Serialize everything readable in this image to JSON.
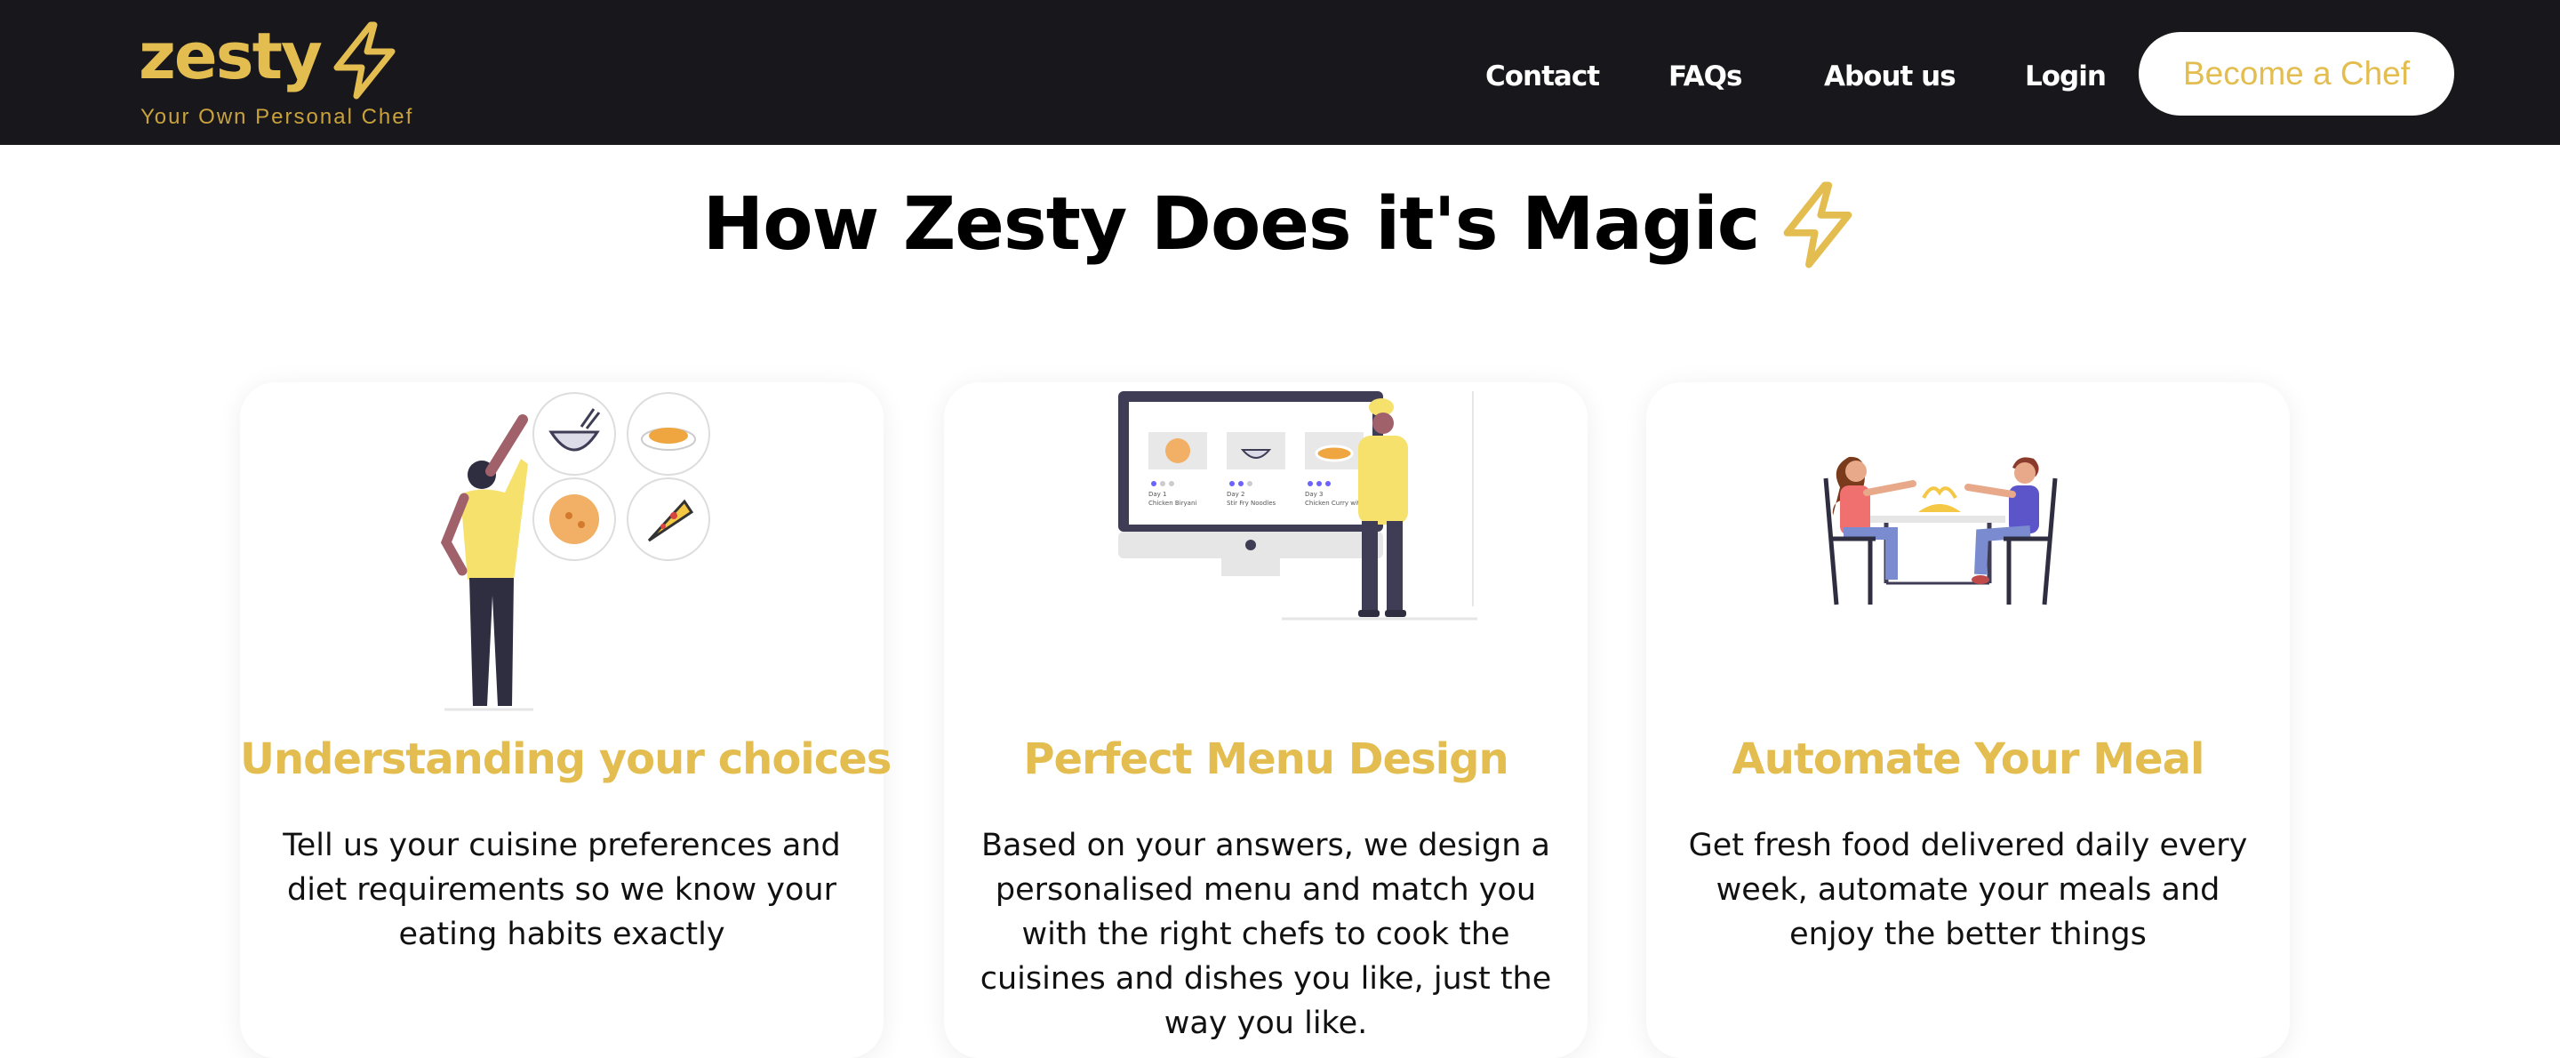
{
  "brand": {
    "name": "zesty",
    "tagline": "Your Own Personal Chef",
    "bolt_icon": "lightning-bolt-icon",
    "accent_color": "#e3bd4f",
    "nav_background": "#18171c"
  },
  "nav": {
    "links": [
      "Contact",
      "FAQs",
      "About us",
      "Login"
    ],
    "cta_label": "Become a Chef"
  },
  "headline": "How Zesty Does it's Magic",
  "cards": [
    {
      "title": "Understanding your choices",
      "body": "Tell us your cuisine preferences and diet requirements so we know your eating habits exactly",
      "illustration": "person-choosing-food-icon"
    },
    {
      "title": "Perfect Menu Design",
      "body": "Based on your answers, we design a personalised menu and match you with the right chefs to cook the cuisines and dishes you like, just the way you like.",
      "illustration": "monitor-menu-chef-icon",
      "screen_labels": [
        "Day 1",
        "Chicken Biryani",
        "Day 2",
        "Stir Fry Noodles",
        "Day 3",
        "Chicken Curry with Rice"
      ]
    },
    {
      "title": "Automate Your Meal",
      "body": "Get fresh food delivered daily every week, automate your meals and enjoy the better things",
      "illustration": "couple-dining-icon"
    }
  ]
}
